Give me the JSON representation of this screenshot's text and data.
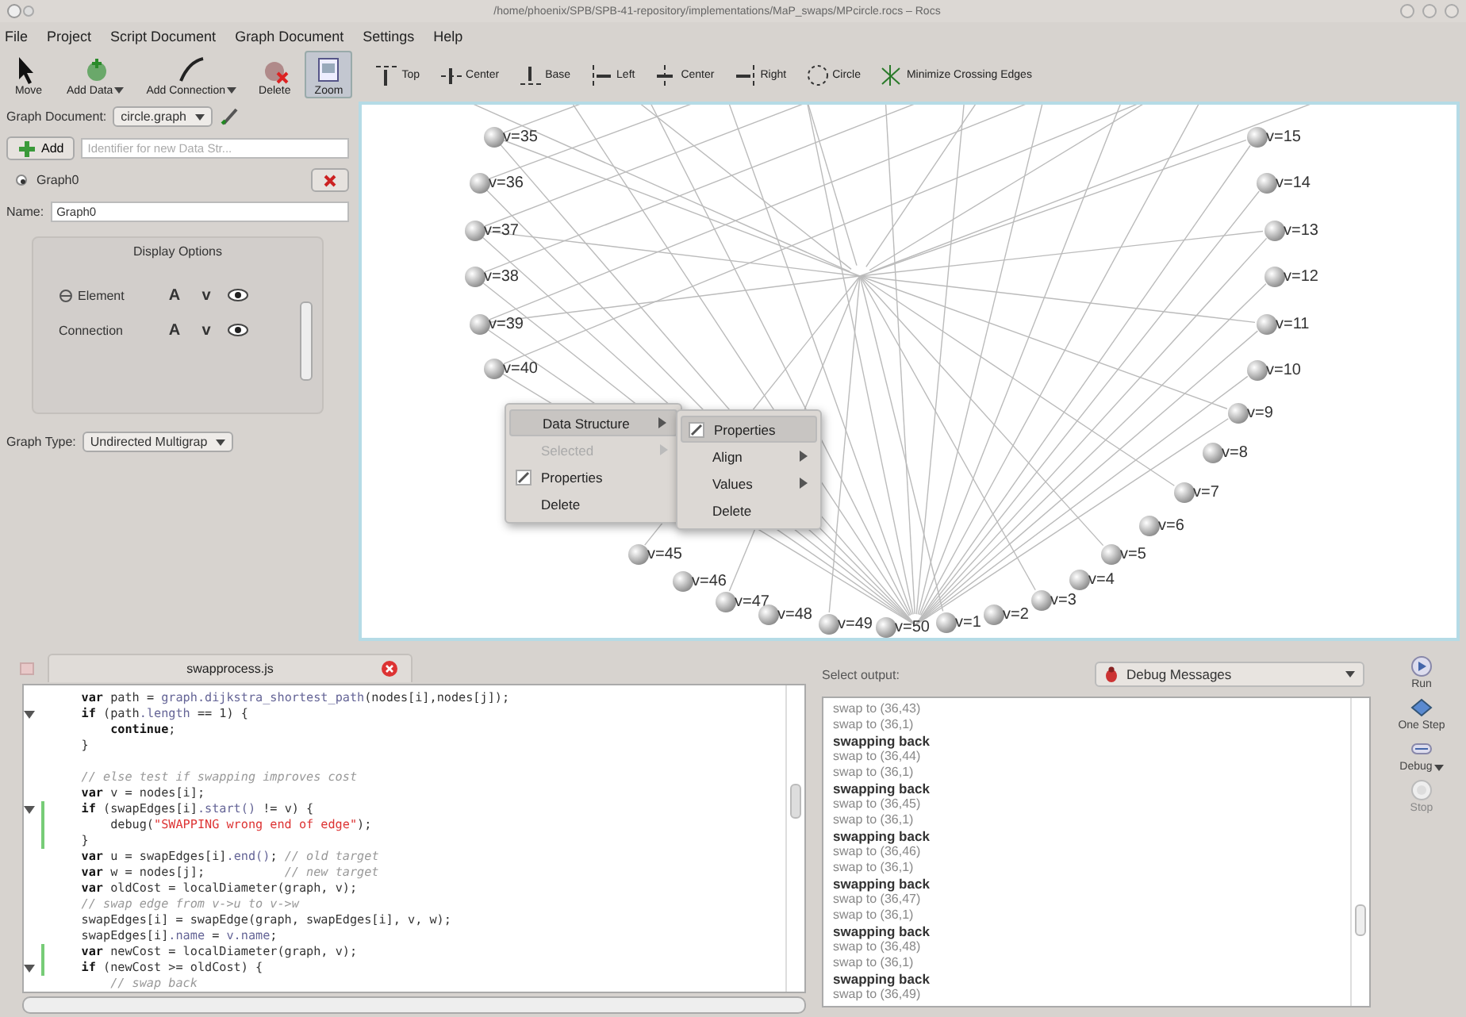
{
  "window": {
    "title": "/home/phoenix/SPB/SPB-41-repository/implementations/MaP_swaps/MPcircle.rocs – Rocs"
  },
  "menu": [
    "File",
    "Project",
    "Script Document",
    "Graph Document",
    "Settings",
    "Help"
  ],
  "toolbar": {
    "tools": [
      {
        "label": "Move",
        "kind": "move",
        "has_menu": false,
        "selected": false
      },
      {
        "label": "Add Data",
        "kind": "add-data",
        "has_menu": true,
        "selected": false
      },
      {
        "label": "Add Connection",
        "kind": "add-connection",
        "has_menu": true,
        "selected": false
      },
      {
        "label": "Delete",
        "kind": "delete",
        "has_menu": false,
        "selected": false
      },
      {
        "label": "Zoom",
        "kind": "zoom",
        "has_menu": false,
        "selected": true
      }
    ],
    "align": [
      {
        "label": "Top",
        "kind": "top"
      },
      {
        "label": "Center",
        "kind": "vcenter"
      },
      {
        "label": "Base",
        "kind": "base"
      },
      {
        "label": "Left",
        "kind": "left"
      },
      {
        "label": "Center",
        "kind": "hcenter"
      },
      {
        "label": "Right",
        "kind": "right"
      },
      {
        "label": "Circle",
        "kind": "circle"
      },
      {
        "label": "Minimize Crossing Edges",
        "kind": "crossing"
      }
    ]
  },
  "document_panel": {
    "document_label": "Graph Document:",
    "document": "circle.graph",
    "add_button": "Add",
    "identifier_placeholder": "Identifier for new Data Str...",
    "structures": [
      {
        "name": "Graph0",
        "selected": true
      }
    ],
    "name_label": "Name:",
    "name_value": "Graph0",
    "display_options": {
      "title": "Display Options",
      "rows": [
        {
          "label": "Element",
          "kind": "element",
          "toggles": [
            "A",
            "v"
          ]
        },
        {
          "label": "Connection",
          "kind": "connection",
          "toggles": [
            "A",
            "v"
          ]
        }
      ]
    },
    "graph_type_label": "Graph Type:",
    "graph_type": "Undirected Multigrap"
  },
  "graph": {
    "nodes": [
      {
        "label": "v=35"
      },
      {
        "label": "v=36"
      },
      {
        "label": "v=37"
      },
      {
        "label": "v=38"
      },
      {
        "label": "v=39"
      },
      {
        "label": "v=40"
      },
      {
        "label": "v=45"
      },
      {
        "label": "v=46"
      },
      {
        "label": "v=47"
      },
      {
        "label": "v=48"
      },
      {
        "label": "v=49"
      },
      {
        "label": "v=50"
      },
      {
        "label": "v=15"
      },
      {
        "label": "v=14"
      },
      {
        "label": "v=13"
      },
      {
        "label": "v=12"
      },
      {
        "label": "v=11"
      },
      {
        "label": "v=10"
      },
      {
        "label": "v=9"
      },
      {
        "label": "v=8"
      },
      {
        "label": "v=7"
      },
      {
        "label": "v=6"
      },
      {
        "label": "v=5"
      },
      {
        "label": "v=4"
      },
      {
        "label": "v=3"
      },
      {
        "label": "v=2"
      },
      {
        "label": "v=1"
      }
    ]
  },
  "context_menu": {
    "items": [
      {
        "label": "Data Structure",
        "kind": "submenu",
        "selected": true,
        "disabled": false
      },
      {
        "label": "Selected",
        "kind": "submenu",
        "selected": false,
        "disabled": true
      },
      {
        "label": "Properties",
        "kind": "icon",
        "selected": false,
        "disabled": false
      },
      {
        "label": "Delete",
        "kind": "plain",
        "selected": false,
        "disabled": false
      }
    ],
    "submenu": [
      {
        "label": "Properties",
        "kind": "icon",
        "selected": true
      },
      {
        "label": "Align",
        "kind": "submenu",
        "selected": false
      },
      {
        "label": "Values",
        "kind": "submenu",
        "selected": false
      },
      {
        "label": "Delete",
        "kind": "plain",
        "selected": false
      }
    ]
  },
  "editor": {
    "tab": "swapprocess.js",
    "lines": [
      {
        "fold": false,
        "modified": false,
        "segments": [
          {
            "kind": "keyword",
            "text": "    var"
          },
          {
            "kind": "plain",
            "text": " path = "
          },
          {
            "kind": "member",
            "text": "graph.dijkstra_shortest_path"
          },
          {
            "kind": "plain",
            "text": "(nodes[i],nodes[j]);"
          }
        ]
      },
      {
        "fold": true,
        "modified": false,
        "segments": [
          {
            "kind": "keyword",
            "text": "    if"
          },
          {
            "kind": "plain",
            "text": " (path"
          },
          {
            "kind": "member",
            "text": ".length"
          },
          {
            "kind": "plain",
            "text": " == 1) {"
          }
        ]
      },
      {
        "fold": false,
        "modified": false,
        "segments": [
          {
            "kind": "keyword",
            "text": "        continue"
          },
          {
            "kind": "plain",
            "text": ";"
          }
        ]
      },
      {
        "fold": false,
        "modified": false,
        "segments": [
          {
            "kind": "plain",
            "text": "    }"
          }
        ]
      },
      {
        "fold": false,
        "modified": false
      },
      {
        "fold": false,
        "modified": false,
        "segments": [
          {
            "kind": "comment",
            "text": "    // else test if swapping improves cost"
          }
        ]
      },
      {
        "fold": false,
        "modified": false,
        "segments": [
          {
            "kind": "keyword",
            "text": "    var"
          },
          {
            "kind": "plain",
            "text": " v = nodes[i];"
          }
        ]
      },
      {
        "fold": true,
        "modified": true,
        "segments": [
          {
            "kind": "keyword",
            "text": "    if"
          },
          {
            "kind": "plain",
            "text": " (swapEdges[i]"
          },
          {
            "kind": "member",
            "text": ".start()"
          },
          {
            "kind": "plain",
            "text": " != v) {"
          }
        ]
      },
      {
        "fold": false,
        "modified": true,
        "segments": [
          {
            "kind": "plain",
            "text": "        debug("
          },
          {
            "kind": "string",
            "text": "\"SWAPPING wrong end of edge\""
          },
          {
            "kind": "plain",
            "text": ");"
          }
        ]
      },
      {
        "fold": false,
        "modified": true,
        "segments": [
          {
            "kind": "plain",
            "text": "    }"
          }
        ]
      },
      {
        "fold": false,
        "modified": false,
        "segments": [
          {
            "kind": "keyword",
            "text": "    var"
          },
          {
            "kind": "plain",
            "text": " u = swapEdges[i]"
          },
          {
            "kind": "member",
            "text": ".end()"
          },
          {
            "kind": "plain",
            "text": "; "
          },
          {
            "kind": "comment",
            "text": "// old target"
          }
        ]
      },
      {
        "fold": false,
        "modified": false,
        "segments": [
          {
            "kind": "keyword",
            "text": "    var"
          },
          {
            "kind": "plain",
            "text": " w = nodes[j];           "
          },
          {
            "kind": "comment",
            "text": "// new target"
          }
        ]
      },
      {
        "fold": false,
        "modified": false,
        "segments": [
          {
            "kind": "keyword",
            "text": "    var"
          },
          {
            "kind": "plain",
            "text": " oldCost = localDiameter(graph, v);"
          }
        ]
      },
      {
        "fold": false,
        "modified": false,
        "segments": [
          {
            "kind": "comment",
            "text": "    // swap edge from v->u to v->w"
          }
        ]
      },
      {
        "fold": false,
        "modified": false,
        "segments": [
          {
            "kind": "plain",
            "text": "    swapEdges[i] = swapEdge(graph, swapEdges[i], v, w);"
          }
        ]
      },
      {
        "fold": false,
        "modified": false,
        "segments": [
          {
            "kind": "plain",
            "text": "    swapEdges[i]"
          },
          {
            "kind": "member",
            "text": ".name"
          },
          {
            "kind": "plain",
            "text": " = "
          },
          {
            "kind": "member",
            "text": "v.name"
          },
          {
            "kind": "plain",
            "text": ";"
          }
        ]
      },
      {
        "fold": false,
        "modified": true,
        "segments": [
          {
            "kind": "keyword",
            "text": "    var"
          },
          {
            "kind": "plain",
            "text": " newCost = localDiameter(graph, v);"
          }
        ]
      },
      {
        "fold": true,
        "modified": true,
        "segments": [
          {
            "kind": "keyword",
            "text": "    if"
          },
          {
            "kind": "plain",
            "text": " (newCost >= oldCost) {"
          }
        ]
      },
      {
        "fold": false,
        "modified": false,
        "segments": [
          {
            "kind": "comment",
            "text": "        // swap back"
          }
        ]
      }
    ]
  },
  "output": {
    "label": "Select output:",
    "selector": "Debug Messages",
    "lines": [
      {
        "text": "swap to (36,43)",
        "kind": "plain"
      },
      {
        "text": "swap to (36,1)",
        "kind": "plain"
      },
      {
        "text": "swapping back",
        "kind": "bold"
      },
      {
        "text": "swap to (36,44)",
        "kind": "plain"
      },
      {
        "text": "swap to (36,1)",
        "kind": "plain"
      },
      {
        "text": "swapping back",
        "kind": "bold"
      },
      {
        "text": "swap to (36,45)",
        "kind": "plain"
      },
      {
        "text": "swap to (36,1)",
        "kind": "plain"
      },
      {
        "text": "swapping back",
        "kind": "bold"
      },
      {
        "text": "swap to (36,46)",
        "kind": "plain"
      },
      {
        "text": "swap to (36,1)",
        "kind": "plain"
      },
      {
        "text": "swapping back",
        "kind": "bold"
      },
      {
        "text": "swap to (36,47)",
        "kind": "plain"
      },
      {
        "text": "swap to (36,1)",
        "kind": "plain"
      },
      {
        "text": "swapping back",
        "kind": "bold"
      },
      {
        "text": "swap to (36,48)",
        "kind": "plain"
      },
      {
        "text": "swap to (36,1)",
        "kind": "plain"
      },
      {
        "text": "swapping back",
        "kind": "bold"
      },
      {
        "text": "swap to (36,49)",
        "kind": "plain"
      }
    ]
  },
  "controls": [
    {
      "label": "Run",
      "kind": "run",
      "has_menu": false,
      "disabled": false
    },
    {
      "label": "One Step",
      "kind": "step",
      "has_menu": false,
      "disabled": false
    },
    {
      "label": "Debug",
      "kind": "debug",
      "has_menu": true,
      "disabled": false
    },
    {
      "label": "Stop",
      "kind": "stop",
      "has_menu": false,
      "disabled": true
    }
  ]
}
